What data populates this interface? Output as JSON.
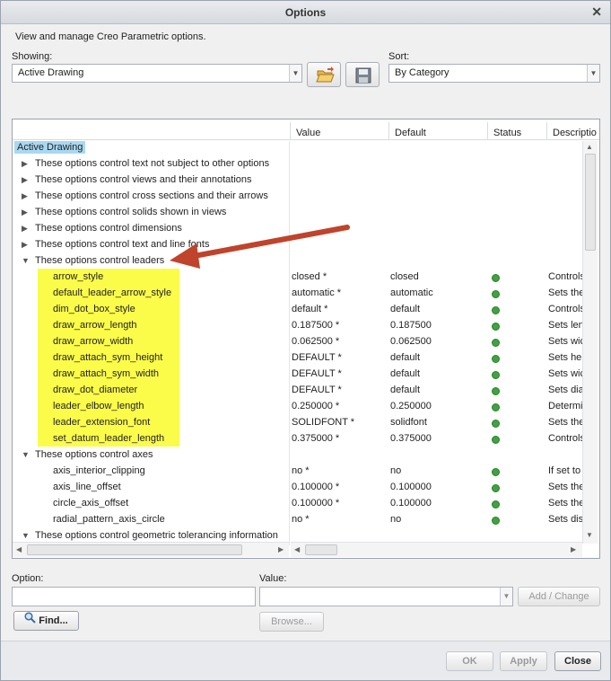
{
  "window": {
    "title": "Options"
  },
  "subtitle": "View and manage Creo Parametric options.",
  "showing": {
    "label": "Showing:",
    "value": "Active Drawing"
  },
  "sort": {
    "label": "Sort:",
    "value": "By Category"
  },
  "columns": {
    "name": "",
    "value": "Value",
    "default": "Default",
    "status": "Status",
    "description": "Descriptio"
  },
  "root": "Active Drawing",
  "categories_collapsed": [
    "These options control text not subject to other options",
    "These options control views and their annotations",
    "These options control cross sections and their arrows",
    "These options control solids shown in views",
    "These options control dimensions",
    "These options control text and line fonts"
  ],
  "leaders_category": "These options control leaders",
  "leader_options": [
    {
      "name": "arrow_style",
      "value": "closed *",
      "default": "closed",
      "desc": "Controls"
    },
    {
      "name": "default_leader_arrow_style",
      "value": "automatic *",
      "default": "automatic",
      "desc": "Sets the"
    },
    {
      "name": "dim_dot_box_style",
      "value": "default *",
      "default": "default",
      "desc": "Controls"
    },
    {
      "name": "draw_arrow_length",
      "value": "0.187500 *",
      "default": "0.187500",
      "desc": "Sets len"
    },
    {
      "name": "draw_arrow_width",
      "value": "0.062500 *",
      "default": "0.062500",
      "desc": "Sets wic"
    },
    {
      "name": "draw_attach_sym_height",
      "value": "DEFAULT *",
      "default": "default",
      "desc": "Sets hei"
    },
    {
      "name": "draw_attach_sym_width",
      "value": "DEFAULT *",
      "default": "default",
      "desc": "Sets wic"
    },
    {
      "name": "draw_dot_diameter",
      "value": "DEFAULT *",
      "default": "default",
      "desc": "Sets dia"
    },
    {
      "name": "leader_elbow_length",
      "value": "0.250000 *",
      "default": "0.250000",
      "desc": "Determin"
    },
    {
      "name": "leader_extension_font",
      "value": "SOLIDFONT *",
      "default": "solidfont",
      "desc": "Sets the"
    },
    {
      "name": "set_datum_leader_length",
      "value": "0.375000 *",
      "default": "0.375000",
      "desc": "Controls"
    }
  ],
  "axes_category": "These options control axes",
  "axes_options": [
    {
      "name": "axis_interior_clipping",
      "value": "no *",
      "default": "no",
      "desc": "If set to"
    },
    {
      "name": "axis_line_offset",
      "value": "0.100000 *",
      "default": "0.100000",
      "desc": "Sets the"
    },
    {
      "name": "circle_axis_offset",
      "value": "0.100000 *",
      "default": "0.100000",
      "desc": "Sets the"
    },
    {
      "name": "radial_pattern_axis_circle",
      "value": "no *",
      "default": "no",
      "desc": "Sets dis"
    }
  ],
  "gdt_category": "These options control geometric tolerancing information",
  "option_field": {
    "label": "Option:",
    "value": ""
  },
  "value_field": {
    "label": "Value:",
    "value": ""
  },
  "buttons": {
    "add_change": "Add / Change",
    "find": "Find...",
    "browse": "Browse...",
    "ok": "OK",
    "apply": "Apply",
    "close": "Close"
  },
  "colors": {
    "highlight": "#fbfb4a",
    "status_ok": "#3fa33f",
    "annotation_arrow": "#c0432b"
  }
}
